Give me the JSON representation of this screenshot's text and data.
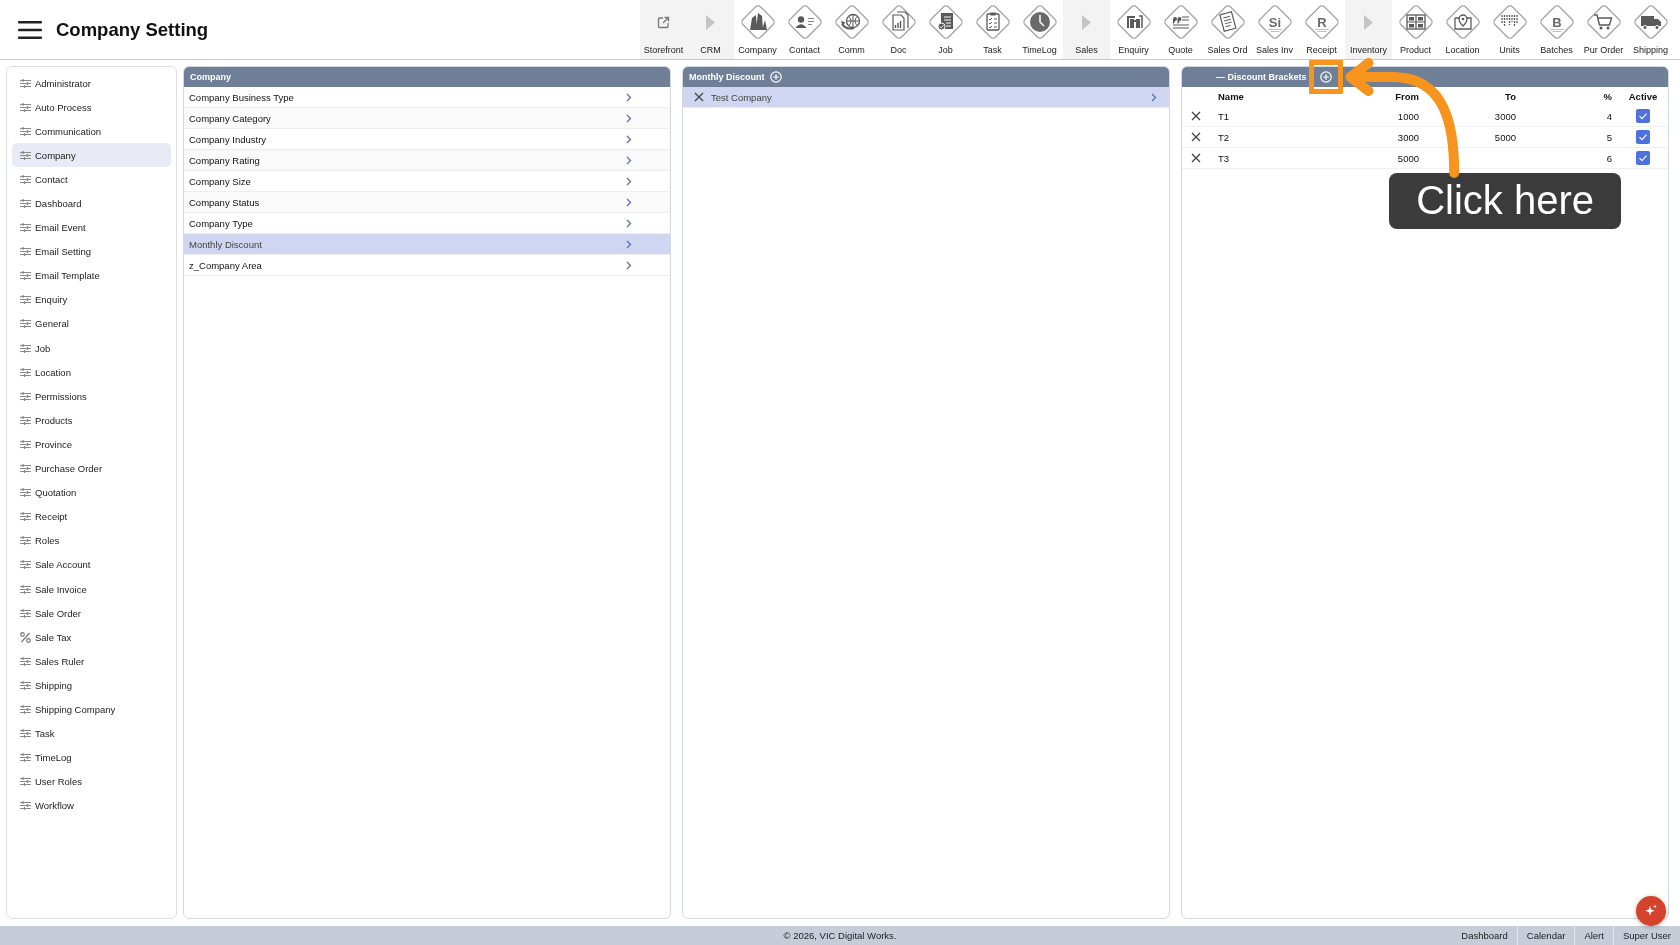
{
  "header": {
    "title": "Company Setting"
  },
  "toolbar": [
    {
      "label": "Storefront",
      "kind": "link"
    },
    {
      "label": "CRM",
      "kind": "group"
    },
    {
      "label": "Company",
      "kind": "module"
    },
    {
      "label": "Contact",
      "kind": "module"
    },
    {
      "label": "Comm",
      "kind": "module"
    },
    {
      "label": "Doc",
      "kind": "module"
    },
    {
      "label": "Job",
      "kind": "module"
    },
    {
      "label": "Task",
      "kind": "module"
    },
    {
      "label": "TimeLog",
      "kind": "module"
    },
    {
      "label": "Sales",
      "kind": "group"
    },
    {
      "label": "Enquiry",
      "kind": "module"
    },
    {
      "label": "Quote",
      "kind": "module"
    },
    {
      "label": "Sales Ord",
      "kind": "module"
    },
    {
      "label": "Sales Inv",
      "kind": "module",
      "icon_text": "Si"
    },
    {
      "label": "Receipt",
      "kind": "module",
      "icon_text": "R"
    },
    {
      "label": "Inventory",
      "kind": "group"
    },
    {
      "label": "Product",
      "kind": "module"
    },
    {
      "label": "Location",
      "kind": "module"
    },
    {
      "label": "Units",
      "kind": "module"
    },
    {
      "label": "Batches",
      "kind": "module",
      "icon_text": "B"
    },
    {
      "label": "Pur Order",
      "kind": "module"
    },
    {
      "label": "Shipping",
      "kind": "module"
    }
  ],
  "sidebar": {
    "items": [
      {
        "label": "Administrator",
        "kind": "list",
        "selected": false
      },
      {
        "label": "Auto Process",
        "kind": "list",
        "selected": false
      },
      {
        "label": "Communication",
        "kind": "list",
        "selected": false
      },
      {
        "label": "Company",
        "kind": "list",
        "selected": true
      },
      {
        "label": "Contact",
        "kind": "list",
        "selected": false
      },
      {
        "label": "Dashboard",
        "kind": "list",
        "selected": false
      },
      {
        "label": "Email Event",
        "kind": "list",
        "selected": false
      },
      {
        "label": "Email Setting",
        "kind": "list",
        "selected": false
      },
      {
        "label": "Email Template",
        "kind": "list",
        "selected": false
      },
      {
        "label": "Enquiry",
        "kind": "list",
        "selected": false
      },
      {
        "label": "General",
        "kind": "list",
        "selected": false
      },
      {
        "label": "Job",
        "kind": "list",
        "selected": false
      },
      {
        "label": "Location",
        "kind": "list",
        "selected": false
      },
      {
        "label": "Permissions",
        "kind": "list",
        "selected": false
      },
      {
        "label": "Products",
        "kind": "list",
        "selected": false
      },
      {
        "label": "Province",
        "kind": "list",
        "selected": false
      },
      {
        "label": "Purchase Order",
        "kind": "list",
        "selected": false
      },
      {
        "label": "Quotation",
        "kind": "list",
        "selected": false
      },
      {
        "label": "Receipt",
        "kind": "list",
        "selected": false
      },
      {
        "label": "Roles",
        "kind": "list",
        "selected": false
      },
      {
        "label": "Sale Account",
        "kind": "list",
        "selected": false
      },
      {
        "label": "Sale Invoice",
        "kind": "list",
        "selected": false
      },
      {
        "label": "Sale Order",
        "kind": "list",
        "selected": false
      },
      {
        "label": "Sale Tax",
        "kind": "tax",
        "selected": false
      },
      {
        "label": "Sales Ruler",
        "kind": "list",
        "selected": false
      },
      {
        "label": "Shipping",
        "kind": "list",
        "selected": false
      },
      {
        "label": "Shipping Company",
        "kind": "list",
        "selected": false
      },
      {
        "label": "Task",
        "kind": "list",
        "selected": false
      },
      {
        "label": "TimeLog",
        "kind": "list",
        "selected": false
      },
      {
        "label": "User Roles",
        "kind": "list",
        "selected": false
      },
      {
        "label": "Workflow",
        "kind": "list",
        "selected": false
      }
    ]
  },
  "company_panel": {
    "title": "Company",
    "items": [
      {
        "label": "Company Business Type",
        "selected": false
      },
      {
        "label": "Company Category",
        "selected": false
      },
      {
        "label": "Company Industry",
        "selected": false
      },
      {
        "label": "Company Rating",
        "selected": false
      },
      {
        "label": "Company Size",
        "selected": false
      },
      {
        "label": "Company Status",
        "selected": false
      },
      {
        "label": "Company Type",
        "selected": false
      },
      {
        "label": "Monthly Discount",
        "selected": true
      },
      {
        "label": "z_Company Area",
        "selected": false
      }
    ]
  },
  "monthly_discount_panel": {
    "title": "Monthly Discount",
    "items": [
      {
        "label": "Test Company",
        "selected": true
      }
    ]
  },
  "discount_brackets_panel": {
    "title": "— Discount Brackets",
    "columns": [
      "Name",
      "From",
      "To",
      "%",
      "Active"
    ],
    "rows": [
      {
        "name": "T1",
        "from": "1000",
        "to": "3000",
        "percent": "4",
        "active": true
      },
      {
        "name": "T2",
        "from": "3000",
        "to": "5000",
        "percent": "5",
        "active": true
      },
      {
        "name": "T3",
        "from": "5000",
        "percent": "6",
        "active": true
      }
    ]
  },
  "annotation": {
    "callout": "Click here"
  },
  "footer": {
    "copyright": "© 2026, VIC Digital Works.",
    "links": [
      "Dashboard",
      "Calendar",
      "Alert",
      "Super User"
    ]
  }
}
